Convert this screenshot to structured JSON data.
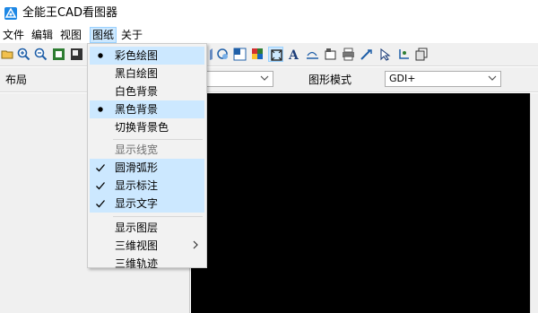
{
  "app": {
    "title": "全能王CAD看图器"
  },
  "menubar": {
    "items": [
      {
        "label": "文件"
      },
      {
        "label": "编辑"
      },
      {
        "label": "视图"
      },
      {
        "label": "图纸"
      },
      {
        "label": "关于"
      }
    ]
  },
  "layout_panel": {
    "title": "布局"
  },
  "render_mode": {
    "label": "图形模式",
    "value": "GDI+"
  },
  "dropdown": {
    "items": [
      {
        "label": "彩色绘图",
        "mark": "radio-dot",
        "checked": true
      },
      {
        "label": "黑白绘图",
        "mark": "",
        "checked": false
      },
      {
        "label": "白色背景",
        "mark": "",
        "checked": false
      },
      {
        "label": "黑色背景",
        "mark": "radio-dot",
        "checked": true
      },
      {
        "label": "切换背景色",
        "mark": "",
        "checked": false
      },
      {
        "label": "显示线宽",
        "mark": "",
        "checked": false
      },
      {
        "label": "圆滑弧形",
        "mark": "check-mark",
        "checked": true
      },
      {
        "label": "显示标注",
        "mark": "check-mark",
        "checked": true
      },
      {
        "label": "显示文字",
        "mark": "check-mark",
        "checked": true
      },
      {
        "label": "显示图层",
        "mark": "",
        "checked": false
      },
      {
        "label": "三维视图",
        "mark": "submenu-arrow",
        "checked": false
      },
      {
        "label": "三维轨迹",
        "mark": "",
        "checked": false
      }
    ]
  },
  "colors": {
    "accent": "#1e88e5",
    "highlight": "#cce8ff",
    "canvas_bg": "#000000"
  }
}
